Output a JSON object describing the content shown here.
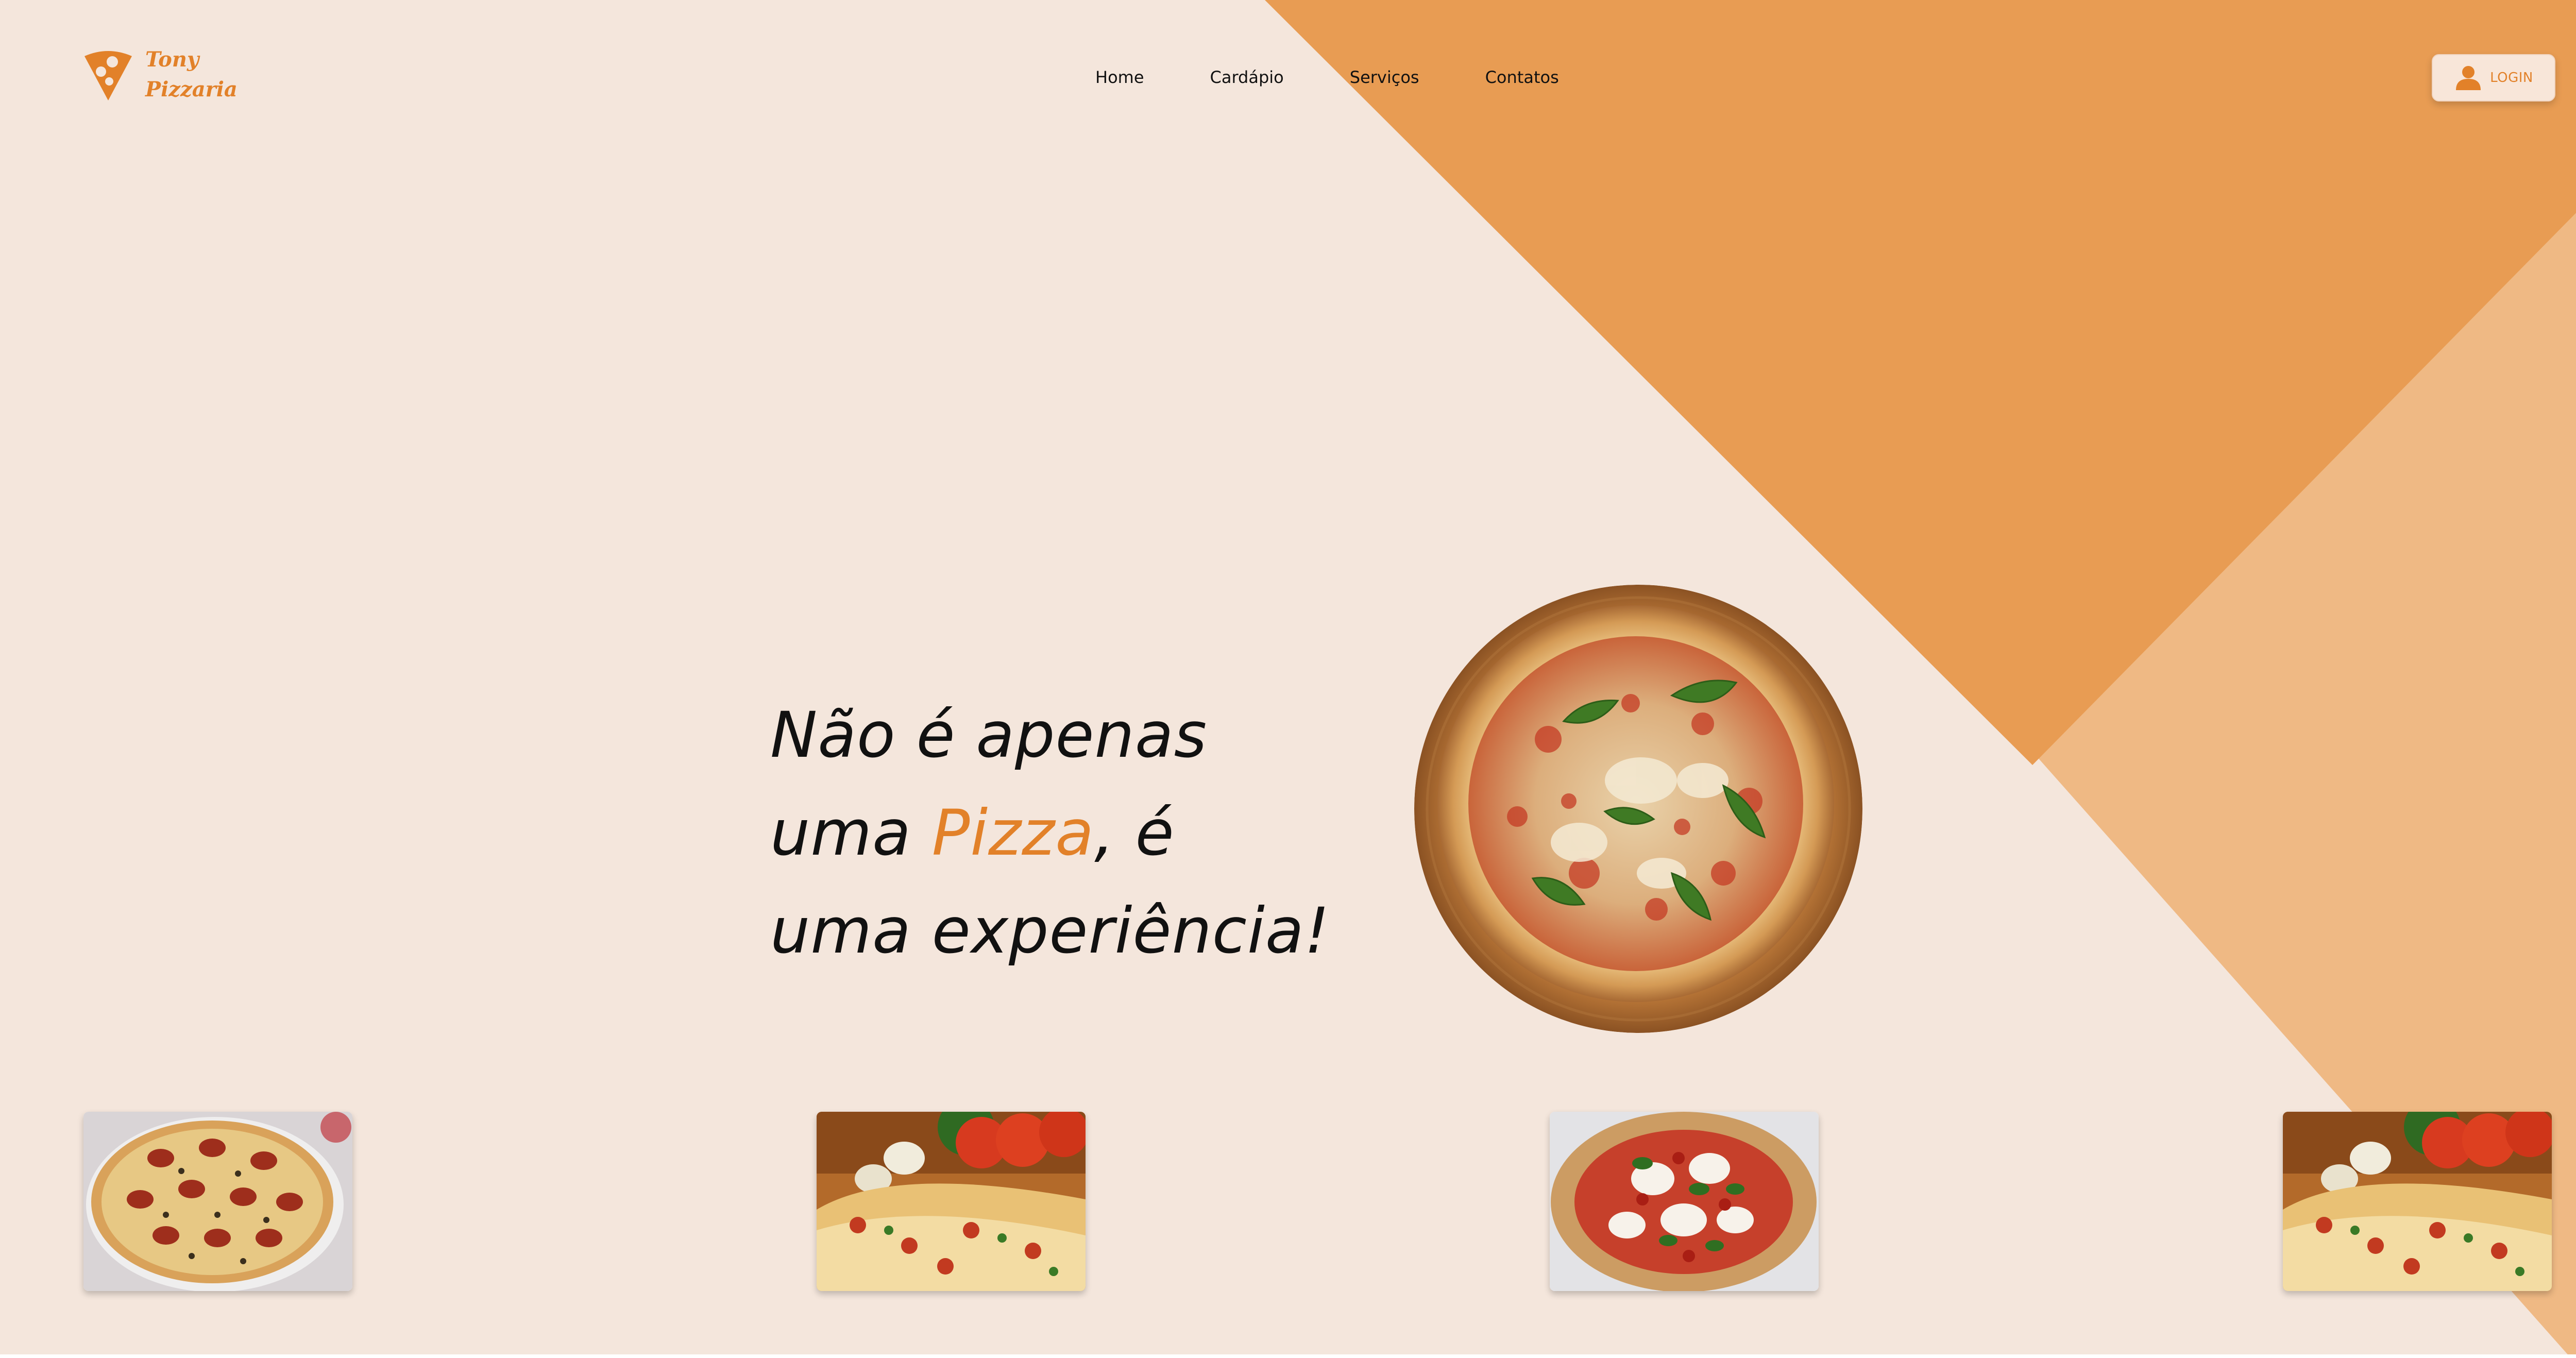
{
  "brand": {
    "name_line1": "Tony",
    "name_line2": "Pizzaria",
    "icon": "pizza-slice-icon"
  },
  "nav": {
    "items": [
      {
        "label": "Home"
      },
      {
        "label": "Cardápio"
      },
      {
        "label": "Serviços"
      },
      {
        "label": "Contatos"
      }
    ]
  },
  "login": {
    "label": "LOGIN",
    "icon": "user-icon"
  },
  "hero": {
    "line1": "Não é apenas",
    "line2_prefix": "uma ",
    "line2_accent": "Pizza",
    "line2_suffix": ", é",
    "line3": "uma experiência!",
    "image": "margherita-pizza-photo"
  },
  "gallery": {
    "items": [
      {
        "image": "pepperoni-olive-pizza-photo"
      },
      {
        "image": "pizza-with-tomatoes-photo"
      },
      {
        "image": "caprese-pizza-photo"
      },
      {
        "image": "pizza-with-tomatoes-photo"
      }
    ]
  },
  "colors": {
    "background": "#f4e6dc",
    "accent": "#e28129",
    "triangle_dark": "#e89c53",
    "triangle_light": "#efb984"
  }
}
